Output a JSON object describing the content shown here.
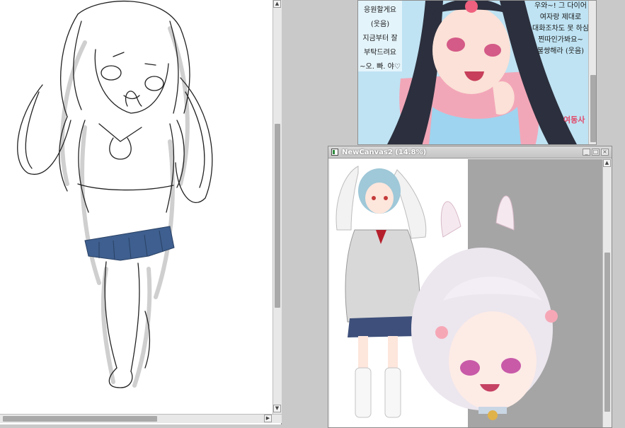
{
  "windows": {
    "canvas_window": {
      "title": "NewCanvas2 (14.8%)"
    },
    "reference": {
      "left_text": [
        "응원할게요",
        "(웃음)",
        "지금부터 잘",
        "부탁드려요",
        "~오. 빠. 야♡"
      ],
      "right_text": [
        "우와~! 그 다이어",
        "여자랑 제대로",
        "대화조차도 못 하심",
        "찐따인가봐요~",
        "불쌍해라 (웃음)"
      ],
      "corner_tag": "여동사"
    }
  },
  "icons": {
    "scroll_up": "▲",
    "scroll_down": "▼",
    "scroll_left": "◀",
    "scroll_right": "▶",
    "minimize": "_",
    "maximize": "□",
    "close": "×"
  },
  "colors": {
    "workspace": "#c9c9c9",
    "titlebar": "#c4c4c4",
    "scroll_thumb": "#a9a9a9"
  }
}
